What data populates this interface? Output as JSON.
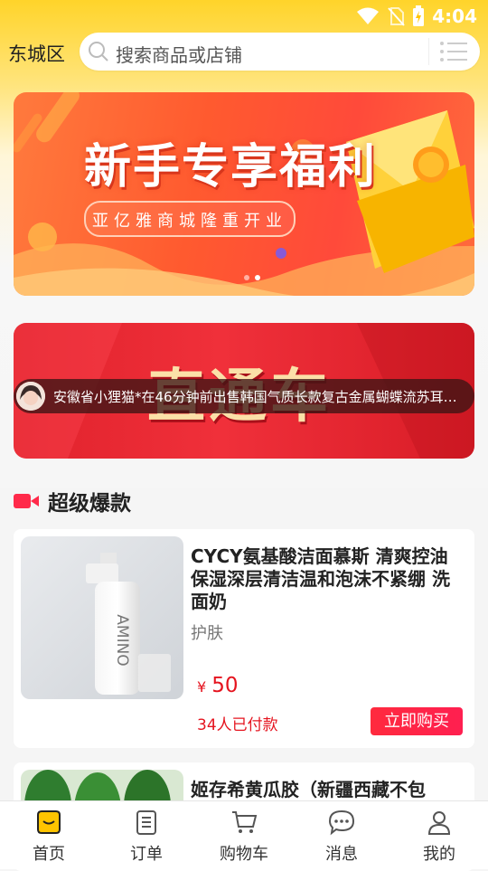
{
  "status_bar": {
    "time": "4:04"
  },
  "header": {
    "city": "东城区",
    "search_placeholder": "搜索商品或店铺"
  },
  "banner1": {
    "title": "新手专享福利",
    "subtitle": "亚亿雅商城隆重开业"
  },
  "banner2": {
    "title": "直通车"
  },
  "ticker": {
    "text": "安徽省小狸猫*在46分钟前出售韩国气质长款复古金属蝴蝶流苏耳环..."
  },
  "section": {
    "title": "超级爆款"
  },
  "products": [
    {
      "name": "CYCY氨基酸洁面慕斯 清爽控油保湿深层清洁温和泡沫不紧绷 洗面奶",
      "category": "护肤",
      "currency": "¥",
      "price": "50",
      "sold": "34人已付款",
      "buy_label": "立即购买",
      "image_text": "AMINO"
    },
    {
      "name": "姬存希黄瓜胶（新疆西藏不包"
    }
  ],
  "tabs": [
    {
      "label": "首页",
      "icon": "home-icon"
    },
    {
      "label": "订单",
      "icon": "order-icon"
    },
    {
      "label": "购物车",
      "icon": "cart-icon"
    },
    {
      "label": "消息",
      "icon": "message-icon"
    },
    {
      "label": "我的",
      "icon": "profile-icon"
    }
  ],
  "colors": {
    "brand_yellow": "#ffd42a",
    "price_red": "#e5141f",
    "button_red": "#ff2a3e"
  }
}
